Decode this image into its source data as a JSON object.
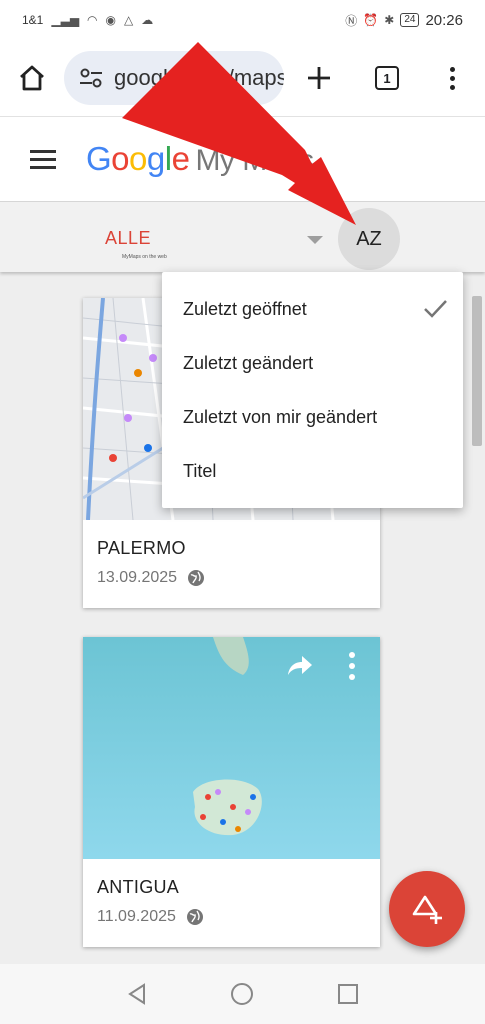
{
  "status_bar": {
    "carrier": "1&1",
    "time": "20:26",
    "battery": "24"
  },
  "browser": {
    "url": "google.com/maps",
    "tab_count": "1"
  },
  "maps_header": {
    "logo_google": [
      "G",
      "o",
      "o",
      "g",
      "l",
      "e"
    ],
    "logo_product": "My Maps"
  },
  "filter": {
    "label": "ALLE",
    "sublabel": "MyMaps on the web",
    "sort_label": "AZ"
  },
  "sort_menu": {
    "items": [
      {
        "label": "Zuletzt geöffnet",
        "checked": true
      },
      {
        "label": "Zuletzt geändert",
        "checked": false
      },
      {
        "label": "Zuletzt von mir geändert",
        "checked": false
      },
      {
        "label": "Titel",
        "checked": false
      }
    ]
  },
  "maps": [
    {
      "title": "PALERMO",
      "date": "13.09.2025",
      "thumb": "city-map"
    },
    {
      "title": "ANTIGUA",
      "date": "11.09.2025",
      "thumb": "island-map"
    }
  ],
  "colors": {
    "accent": "#db4437",
    "arrow": "#e52220"
  },
  "icons": [
    "home-icon",
    "tune-icon",
    "plus-icon",
    "tabs-icon",
    "more-vert-icon",
    "hamburger-icon",
    "sort-az-icon",
    "check-icon",
    "globe-icon",
    "share-icon",
    "create-map-icon",
    "back-icon",
    "home-circle-icon",
    "recents-icon"
  ]
}
